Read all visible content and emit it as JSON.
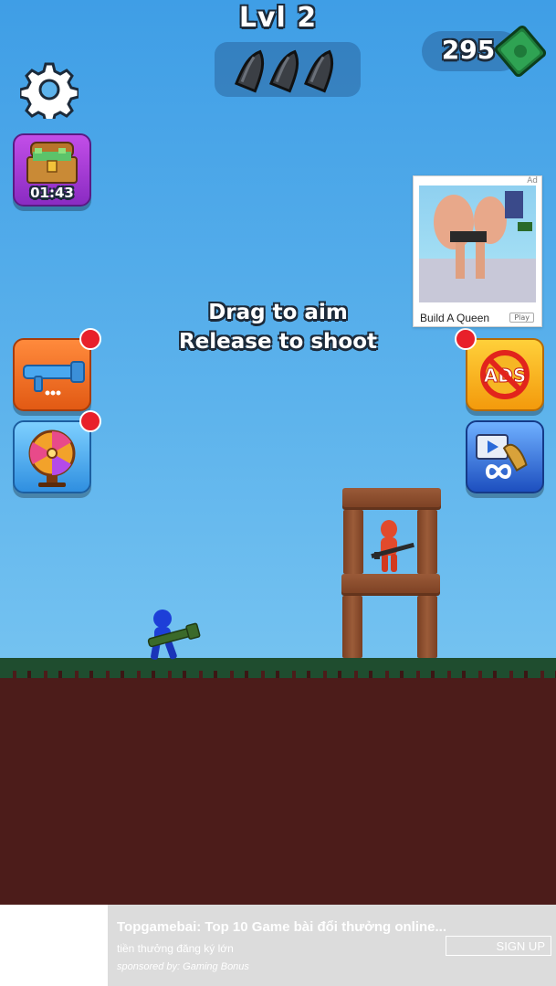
{
  "hud": {
    "level_label": "Lvl 2",
    "ammo": {
      "remaining": 3,
      "icon": "bullet-icon"
    },
    "money": {
      "value": "295",
      "icon": "cash-icon"
    }
  },
  "left_buttons": {
    "settings_icon": "gear-icon",
    "chest": {
      "icon": "treasure-chest-icon",
      "timer": "01:43"
    },
    "weapon": {
      "icon": "bazooka-icon",
      "notification": true
    },
    "wheel": {
      "icon": "prize-wheel-icon",
      "notification": true
    }
  },
  "right_buttons": {
    "no_ads": {
      "icon": "no-ads-icon",
      "notification": true
    },
    "video_bonus": {
      "icon": "video-infinity-icon"
    }
  },
  "hint": {
    "line1": "Drag to aim",
    "line2": "Release to shoot"
  },
  "ad_card": {
    "badge": "Ad",
    "title": "Build A Queen",
    "play": "Play"
  },
  "banner": {
    "title": "Topgamebai: Top 10 Game bài đổi thưởng online...",
    "subtitle": "tiền thưởng đăng ký lớn",
    "sponsor": "sponsored by: Gaming Bonus",
    "cta": "SIGN UP"
  },
  "colors": {
    "sky_top": "#3f9ee6",
    "sky_bottom": "#8ad1f5",
    "grass": "#1f4d2f",
    "dirt": "#4c1c1a",
    "player": "#1d3fd8",
    "enemy": "#e24a2c",
    "wood": "#8a4b2d"
  }
}
